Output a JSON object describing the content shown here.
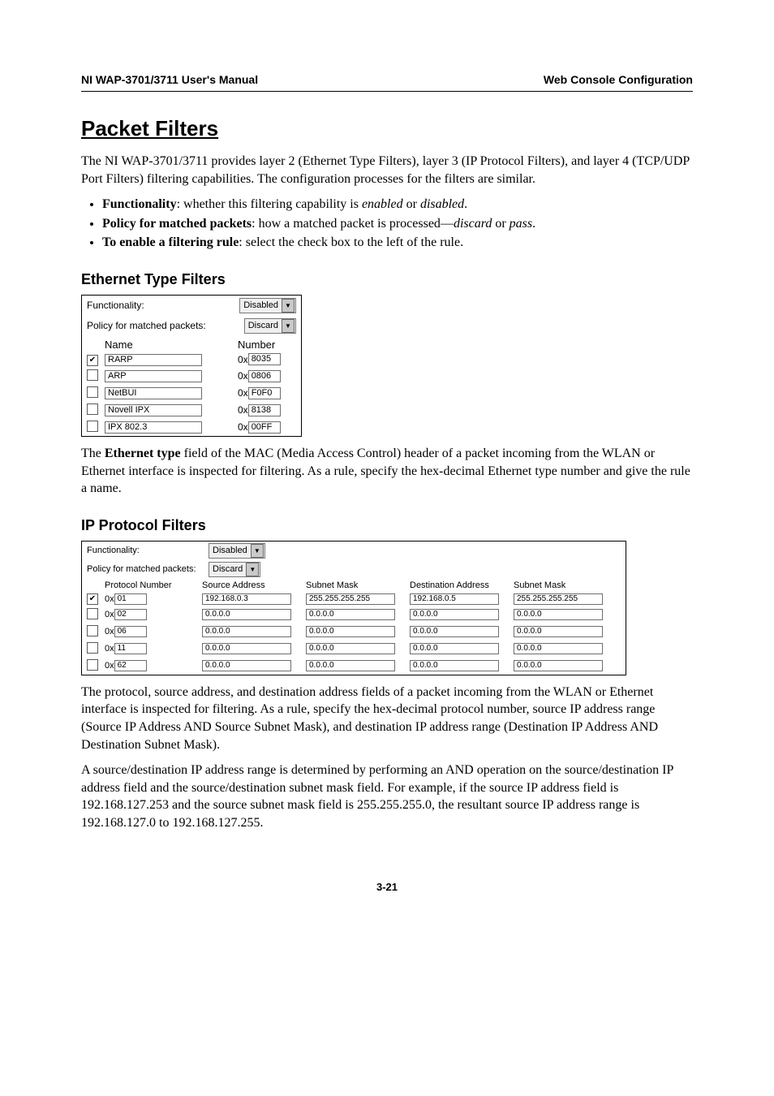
{
  "header": {
    "left": "NI WAP-3701/3711 User's Manual",
    "right": "Web Console Configuration"
  },
  "section": "Packet Filters",
  "intro": "The NI WAP-3701/3711 provides layer 2 (Ethernet Type Filters), layer 3 (IP Protocol Filters), and layer 4 (TCP/UDP Port Filters) filtering capabilities. The configuration processes for the filters are similar.",
  "bullets": {
    "b1_bold": "Functionality",
    "b1_tail": ": whether this filtering capability is ",
    "b1_i1": "enabled",
    "b1_mid": " or ",
    "b1_i2": "disabled",
    "b1_end": ".",
    "b2_bold": "Policy for matched packets",
    "b2_tail": ": how a matched packet is processed—",
    "b2_i1": "discard",
    "b2_mid": " or ",
    "b2_i2": "pass",
    "b2_end": ".",
    "b3_bold": "To enable a filtering rule",
    "b3_tail": ": select the check box to the left of the rule."
  },
  "sub1": {
    "title": "Ethernet Type Filters",
    "fig": {
      "functionality_label": "Functionality:",
      "functionality_value": "Disabled",
      "policy_label": "Policy for matched packets:",
      "policy_value": "Discard",
      "col_name": "Name",
      "col_number": "Number",
      "ox": "0x",
      "rows": [
        {
          "checked": true,
          "name": "RARP",
          "num": "8035"
        },
        {
          "checked": false,
          "name": "ARP",
          "num": "0806"
        },
        {
          "checked": false,
          "name": "NetBUI",
          "num": "F0F0"
        },
        {
          "checked": false,
          "name": "Novell IPX",
          "num": "8138"
        },
        {
          "checked": false,
          "name": "IPX 802.3",
          "num": "00FF"
        }
      ]
    },
    "para_pre": "The ",
    "para_bold": "Ethernet type",
    "para_post": " field of the MAC (Media Access Control) header of a packet incoming from the WLAN or Ethernet interface is inspected for filtering. As a rule, specify the hex-decimal Ethernet type number and give the rule a name."
  },
  "sub2": {
    "title": "IP Protocol Filters",
    "fig": {
      "functionality_label": "Functionality:",
      "functionality_value": "Disabled",
      "policy_label": "Policy for matched packets:",
      "policy_value": "Discard",
      "ox": "0x",
      "cols": {
        "pn": "Protocol Number",
        "sa": "Source Address",
        "sm1": "Subnet Mask",
        "da": "Destination Address",
        "sm2": "Subnet Mask"
      },
      "rows": [
        {
          "checked": true,
          "pn": "01",
          "sa": "192.168.0.3",
          "sm1": "255.255.255.255",
          "da": "192.168.0.5",
          "sm2": "255.255.255.255"
        },
        {
          "checked": false,
          "pn": "02",
          "sa": "0.0.0.0",
          "sm1": "0.0.0.0",
          "da": "0.0.0.0",
          "sm2": "0.0.0.0"
        },
        {
          "checked": false,
          "pn": "06",
          "sa": "0.0.0.0",
          "sm1": "0.0.0.0",
          "da": "0.0.0.0",
          "sm2": "0.0.0.0"
        },
        {
          "checked": false,
          "pn": "11",
          "sa": "0.0.0.0",
          "sm1": "0.0.0.0",
          "da": "0.0.0.0",
          "sm2": "0.0.0.0"
        },
        {
          "checked": false,
          "pn": "62",
          "sa": "0.0.0.0",
          "sm1": "0.0.0.0",
          "da": "0.0.0.0",
          "sm2": "0.0.0.0"
        }
      ]
    },
    "p1": "The protocol, source address, and destination address fields of a packet incoming from the WLAN or Ethernet interface is inspected for filtering. As a rule, specify the hex-decimal protocol number, source IP address range (Source IP Address AND Source Subnet Mask), and destination IP address range (Destination IP Address AND Destination Subnet Mask).",
    "p2": "A source/destination IP address range is determined by performing an AND operation on the source/destination IP address field and the source/destination subnet mask field. For example, if the source IP address field is 192.168.127.253 and the source subnet mask field is 255.255.255.0, the resultant source IP address range is 192.168.127.0 to 192.168.127.255."
  },
  "page_number": "3-21"
}
